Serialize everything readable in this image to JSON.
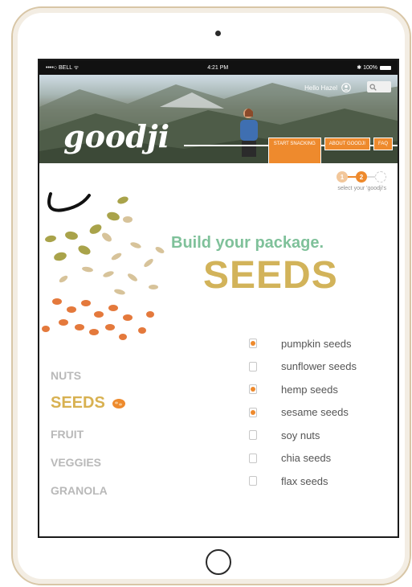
{
  "status": {
    "carrier": "••••○ BELL ᯤ",
    "time": "4:21 PM",
    "battery": "✱ 100%"
  },
  "header": {
    "greeting": "Hello Hazel",
    "logo_text": "goodji",
    "nav": [
      "START SNACKING",
      "ABOUT GOODJI",
      "FAQ"
    ]
  },
  "steps": {
    "items": [
      "1",
      "2",
      "3"
    ],
    "current": 2,
    "caption": "select your 'goodji's"
  },
  "main": {
    "headline": "Build your package.",
    "category_title": "SEEDS"
  },
  "categories": [
    {
      "label": "NUTS",
      "active": false
    },
    {
      "label": "SEEDS",
      "active": true
    },
    {
      "label": "FRUIT",
      "active": false
    },
    {
      "label": "VEGGIES",
      "active": false
    },
    {
      "label": "GRANOLA",
      "active": false
    }
  ],
  "options": [
    {
      "label": "pumpkin seeds",
      "checked": true
    },
    {
      "label": "sunflower seeds",
      "checked": false
    },
    {
      "label": "hemp seeds",
      "checked": true
    },
    {
      "label": "sesame seeds",
      "checked": true
    },
    {
      "label": "soy nuts",
      "checked": false
    },
    {
      "label": "chia seeds",
      "checked": false
    },
    {
      "label": "flax seeds",
      "checked": false
    }
  ],
  "colors": {
    "accent": "#ee8a2d",
    "green": "#7fc19a",
    "gold": "#d2b35a"
  }
}
